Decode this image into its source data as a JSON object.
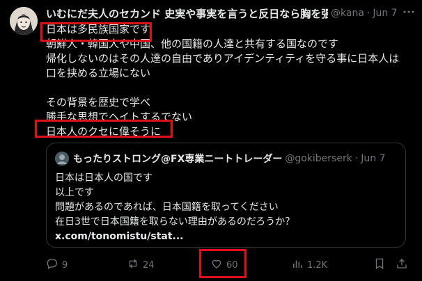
{
  "tweet": {
    "display_name": "いむにだ夫人のセカンド 史実や事実を言うと反日なら胸を張る",
    "handle": "@kana",
    "dot": "·",
    "time": "Jun 7",
    "more_icon": "more-dots-icon",
    "lines": [
      "日本は多民族国家です",
      "朝鮮人・韓国人や中国、他の国籍の人達と共有する国なのです",
      "帰化しないのはその人達の自由でありアイデンティティを守る事に日本人は",
      "口を挟める立場にない",
      "",
      "その背景を歴史で学べ",
      "勝手な思想でヘイトするでない",
      "日本人のクセに偉そうに"
    ]
  },
  "quote": {
    "display_name": "もったりストロング@FX専業ニートトレーダー",
    "handle": "@gokiberserk",
    "dot": "·",
    "time": "Jun 7",
    "lines": [
      "日本は日本人の国です",
      "以上です",
      "問題があるのであれば、日本国籍を取ってください",
      "在日3世で日本国籍を取らない理由があるのだろうか？"
    ],
    "link": "x.com/tonomistu/stat..."
  },
  "actions": {
    "reply_count": "9",
    "retweet_count": "24",
    "like_count": "60",
    "view_count": "1.2K"
  },
  "colors": {
    "background": "#000000",
    "text": "#e7e9ea",
    "muted": "#71767b",
    "highlight": "#e0101a"
  }
}
